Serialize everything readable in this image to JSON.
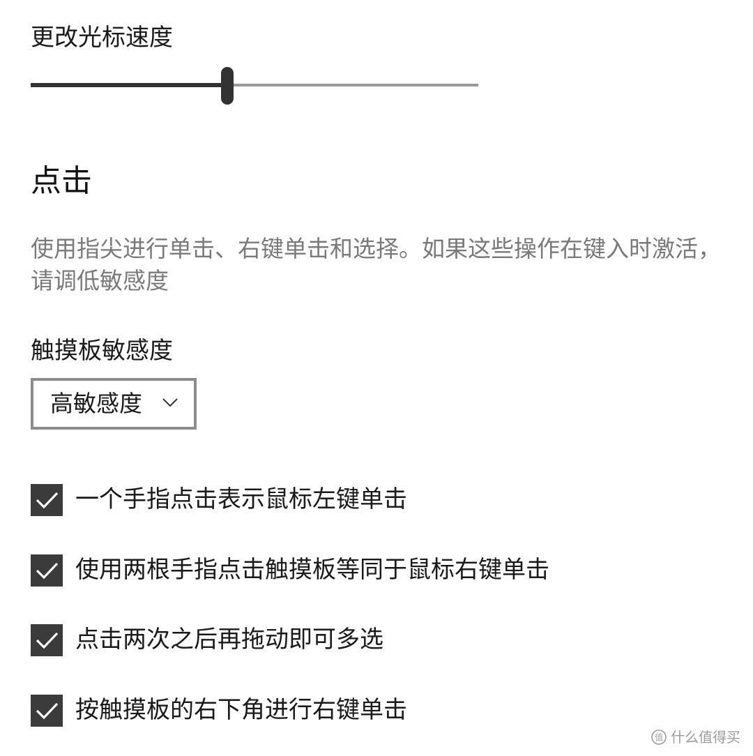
{
  "cursor_speed": {
    "label": "更改光标速度",
    "value_fraction": 0.44
  },
  "click_section": {
    "title": "点击",
    "description": "使用指尖进行单击、右键单击和选择。如果这些操作在键入时激活，请调低敏感度"
  },
  "sensitivity": {
    "label": "触摸板敏感度",
    "selected": "高敏感度"
  },
  "options": [
    {
      "label": "一个手指点击表示鼠标左键单击",
      "checked": true
    },
    {
      "label": "使用两根手指点击触摸板等同于鼠标右键单击",
      "checked": true
    },
    {
      "label": "点击两次之后再拖动即可多选",
      "checked": true
    },
    {
      "label": "按触摸板的右下角进行右键单击",
      "checked": true
    }
  ],
  "watermark": {
    "text": "什么值得买",
    "logo_icon": "zhide-logo-icon"
  },
  "colors": {
    "checkbox_fill": "#3b3b3b",
    "slider_active": "#333333",
    "slider_inactive": "#9a9a9a",
    "description_text": "#7a7a7a"
  }
}
